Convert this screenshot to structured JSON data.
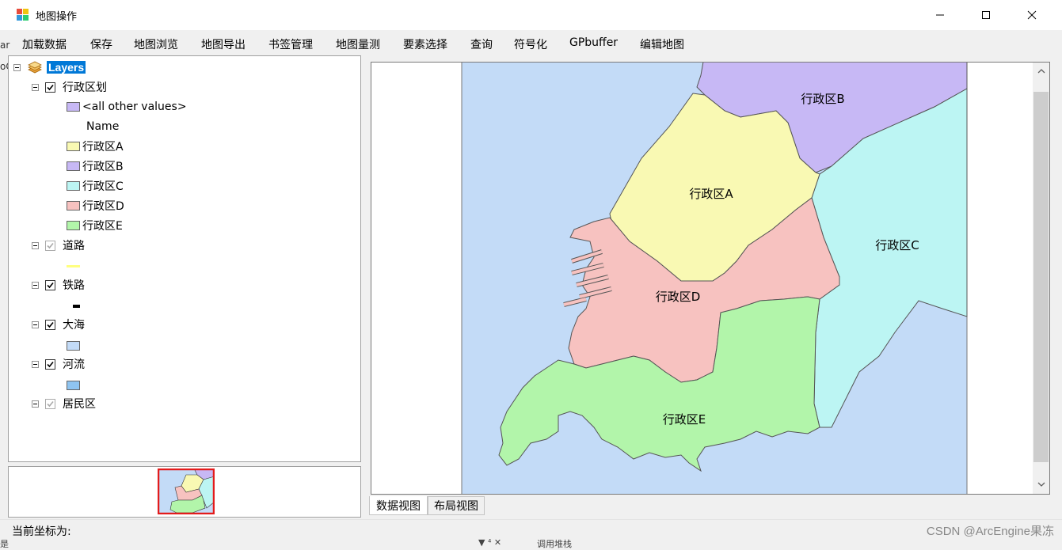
{
  "window": {
    "title": "地图操作",
    "min_glyph": "—",
    "max_glyph": "☐",
    "close_glyph": "✕"
  },
  "menu": [
    {
      "label": "加载数据"
    },
    {
      "label": "保存"
    },
    {
      "label": "地图浏览"
    },
    {
      "label": "地图导出"
    },
    {
      "label": "书签管理"
    },
    {
      "label": "地图量测"
    },
    {
      "label": "要素选择"
    },
    {
      "label": "查询"
    },
    {
      "label": "符号化"
    },
    {
      "label": "GPbuffer"
    },
    {
      "label": "编辑地图"
    }
  ],
  "left_clip": {
    "top": "ar",
    "mid": "oC"
  },
  "toc": {
    "root": "Layers",
    "layers": {
      "xingzheng": {
        "name": "行政区划",
        "checked": true,
        "legend_other": "<all other values>",
        "legend_field": "Name",
        "classes": [
          {
            "label": "行政区A",
            "color": "#f9f9b3"
          },
          {
            "label": "行政区B",
            "color": "#c7b8f5"
          },
          {
            "label": "行政区C",
            "color": "#bcf5f3"
          },
          {
            "label": "行政区D",
            "color": "#f7c2c0"
          },
          {
            "label": "行政区E",
            "color": "#b2f5aa"
          }
        ],
        "other_color": "#c7b8f5"
      },
      "daolu": {
        "name": "道路",
        "checked": false,
        "color": "#ffff80"
      },
      "tielu": {
        "name": "铁路",
        "checked": true,
        "color": "#000000"
      },
      "dahai": {
        "name": "大海",
        "checked": true,
        "color": "#c3dbf7"
      },
      "heliu": {
        "name": "河流",
        "checked": true,
        "color": "#8fc4f0"
      },
      "jumin": {
        "name": "居民区",
        "checked": false
      }
    }
  },
  "map": {
    "labels": {
      "a": "行政区A",
      "b": "行政区B",
      "c": "行政区C",
      "d": "行政区D",
      "e": "行政区E"
    },
    "sea_color": "#c3dbf7"
  },
  "tabs": {
    "data_view": "数据视图",
    "layout_view": "布局视图"
  },
  "status": {
    "coords_label": "当前坐标为:"
  },
  "watermark": "CSDN @ArcEngine果冻",
  "under_text": {
    "left": "是",
    "arrows": "▼ ⁴ ✕",
    "right": "调用堆栈"
  }
}
